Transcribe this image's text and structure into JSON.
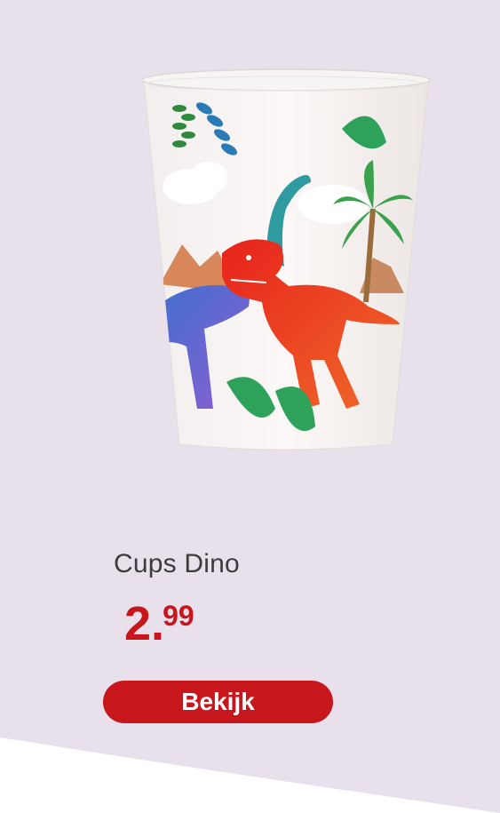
{
  "product": {
    "title": "Cups Dino",
    "price_int": "2",
    "price_sep": ".",
    "price_cents": "99",
    "image_name": "dino-paper-cup"
  },
  "cta": {
    "label": "Bekijk"
  },
  "colors": {
    "background_tint": "#e8e1ec",
    "price_red": "#c8161d",
    "button_red": "#c8161d",
    "title_gray": "#3c3c3c"
  }
}
